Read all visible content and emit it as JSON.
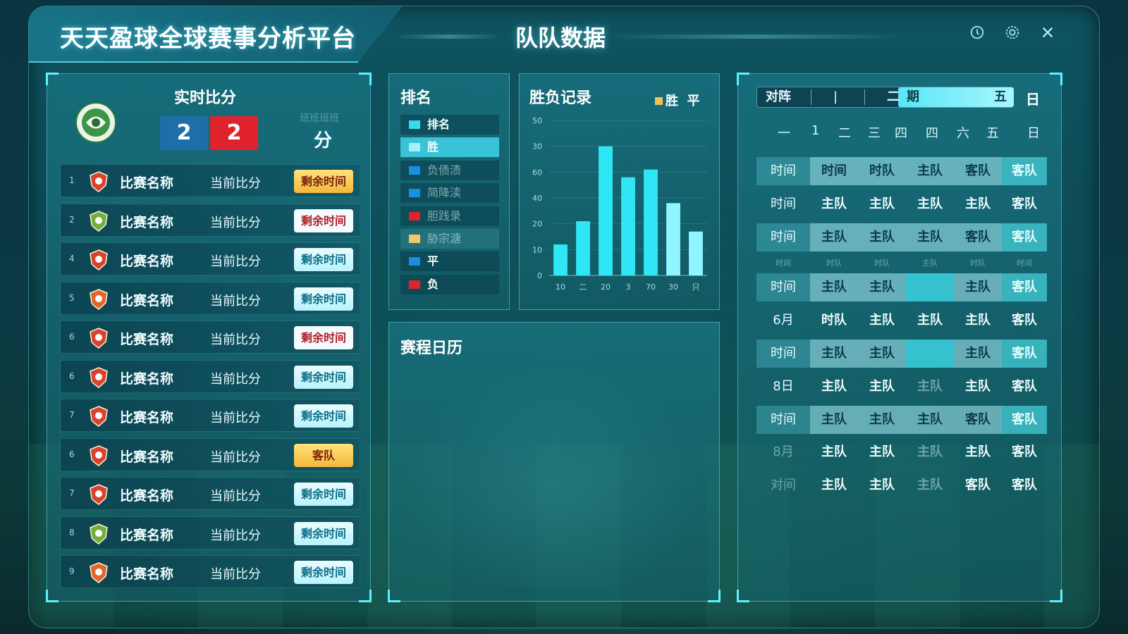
{
  "app": {
    "title": "天天盈球全球赛事分析平台",
    "page_title": "队队数据"
  },
  "window_controls": {
    "help_icon": "question-icon",
    "settings_icon": "gear-icon",
    "close_icon": "close-icon"
  },
  "live": {
    "title": "实时比分",
    "home_score": "2",
    "away_score": "2",
    "side_faint": "班班班班",
    "side_big": "分",
    "matches": [
      {
        "idx": "1",
        "name": "比赛名称",
        "score": "当前比分",
        "tag": "剩余时间",
        "tag_style": "gold",
        "badge_color": "#d9422e"
      },
      {
        "idx": "2",
        "name": "比赛名称",
        "score": "当前比分",
        "tag": "剩余时间",
        "tag_style": "white",
        "badge_color": "#6fb13a"
      },
      {
        "idx": "4",
        "name": "比赛名称",
        "score": "当前比分",
        "tag": "剩余时间",
        "tag_style": "cyan",
        "badge_color": "#d9422e"
      },
      {
        "idx": "5",
        "name": "比赛名称",
        "score": "当前比分",
        "tag": "剩余时间",
        "tag_style": "cyan",
        "badge_color": "#e0672c"
      },
      {
        "idx": "6",
        "name": "比赛名称",
        "score": "当前比分",
        "tag": "剩余时间",
        "tag_style": "white",
        "badge_color": "#d9422e"
      },
      {
        "idx": "6",
        "name": "比赛名称",
        "score": "当前比分",
        "tag": "剩余时间",
        "tag_style": "cyan",
        "badge_color": "#d9422e"
      },
      {
        "idx": "7",
        "name": "比赛名称",
        "score": "当前比分",
        "tag": "剩余时间",
        "tag_style": "cyan",
        "badge_color": "#d9422e"
      },
      {
        "idx": "6",
        "name": "比赛名称",
        "score": "当前比分",
        "tag": "客队",
        "tag_style": "gold",
        "badge_color": "#d9422e"
      },
      {
        "idx": "7",
        "name": "比赛名称",
        "score": "当前比分",
        "tag": "剩余时间",
        "tag_style": "cyan",
        "badge_color": "#d9422e"
      },
      {
        "idx": "8",
        "name": "比赛名称",
        "score": "当前比分",
        "tag": "剩余时间",
        "tag_style": "cyan",
        "badge_color": "#6fb13a"
      },
      {
        "idx": "9",
        "name": "比赛名称",
        "score": "当前比分",
        "tag": "剩余时间",
        "tag_style": "cyan",
        "badge_color": "#e0672c"
      }
    ]
  },
  "ranking": {
    "title": "排名",
    "items": [
      {
        "label": "排名",
        "color": "#39d9ef",
        "selected": false,
        "faint": false
      },
      {
        "label": "胜",
        "color": "#9ff2fb",
        "selected": true,
        "faint": false
      },
      {
        "label": "负债渍",
        "color": "#1a8fe0",
        "selected": false,
        "faint": true
      },
      {
        "label": "简降渎",
        "color": "#1a8fe0",
        "selected": false,
        "faint": true
      },
      {
        "label": "胆践录",
        "color": "#e0222c",
        "selected": false,
        "faint": true
      },
      {
        "label": "胁宗溏",
        "color": "#f0c86a",
        "selected": false,
        "faint": true
      },
      {
        "label": "平",
        "color": "#1a8fe0",
        "selected": false,
        "faint": false
      },
      {
        "label": "负",
        "color": "#e0222c",
        "selected": false,
        "faint": false
      }
    ]
  },
  "record": {
    "title": "胜负记录",
    "legend_win": "胜",
    "legend_draw": "平"
  },
  "chart_data": {
    "type": "bar",
    "title": "胜负记录",
    "categories": [
      "10",
      "二",
      "20",
      "3",
      "70",
      "30",
      "只"
    ],
    "values": [
      12,
      21,
      50,
      38,
      41,
      28,
      17
    ],
    "y_ticks": [
      "0",
      "10",
      "20",
      "40",
      "60",
      "30",
      "50"
    ],
    "ylim": [
      0,
      60
    ],
    "legend": [
      "胜",
      "平"
    ],
    "colors": {
      "bar": "#2fe6f5",
      "highlight": "#8ff5ff"
    }
  },
  "calendar": {
    "title": "赛程日历"
  },
  "fixtures": {
    "week_tabs": [
      "对阵",
      "|",
      "|",
      "二",
      "期",
      "五"
    ],
    "week_sun": "日",
    "days": [
      "一",
      "1",
      "二",
      "三",
      "四",
      "四",
      "六",
      "五",
      "日"
    ],
    "rows": [
      {
        "cells": [
          "时间",
          "时间",
          "时队",
          "主队",
          "客队",
          "客队"
        ],
        "hl": true,
        "small": false,
        "gap": false
      },
      {
        "cells": [
          "时间",
          "主队",
          "主队",
          "主队",
          "主队",
          "客队"
        ],
        "hl": false,
        "small": false,
        "gap": false
      },
      {
        "cells": [
          "时间",
          "主队",
          "主队",
          "主队",
          "客队",
          "客队"
        ],
        "hl": true,
        "small": false,
        "gap": false
      },
      {
        "cells": [
          "时间",
          "时队",
          "时队",
          "主队",
          "时队",
          "时间"
        ],
        "hl": false,
        "small": true,
        "gap": false
      },
      {
        "cells": [
          "时间",
          "主队",
          "主队",
          "",
          "主队",
          "客队"
        ],
        "hl": true,
        "small": false,
        "gap": true
      },
      {
        "cells": [
          "6月",
          "时队",
          "主队",
          "主队",
          "主队",
          "客队"
        ],
        "hl": false,
        "small": false,
        "gap": false
      },
      {
        "cells": [
          "时间",
          "主队",
          "主队",
          "",
          "主队",
          "客队"
        ],
        "hl": true,
        "small": false,
        "gap": true
      },
      {
        "cells": [
          "8日",
          "主队",
          "主队",
          "主队",
          "主队",
          "客队"
        ],
        "hl": false,
        "small": false,
        "gap": false
      },
      {
        "cells": [
          "时间",
          "主队",
          "主队",
          "主队",
          "客队",
          "客队"
        ],
        "hl": true,
        "small": false,
        "gap": false
      },
      {
        "cells": [
          "8月",
          "主队",
          "主队",
          "主队",
          "主队",
          "客队"
        ],
        "hl": false,
        "small": false,
        "gap": false
      },
      {
        "cells": [
          "对间",
          "主队",
          "主队",
          "主队",
          "客队",
          "客队"
        ],
        "hl": false,
        "small": false,
        "gap": false
      }
    ]
  }
}
